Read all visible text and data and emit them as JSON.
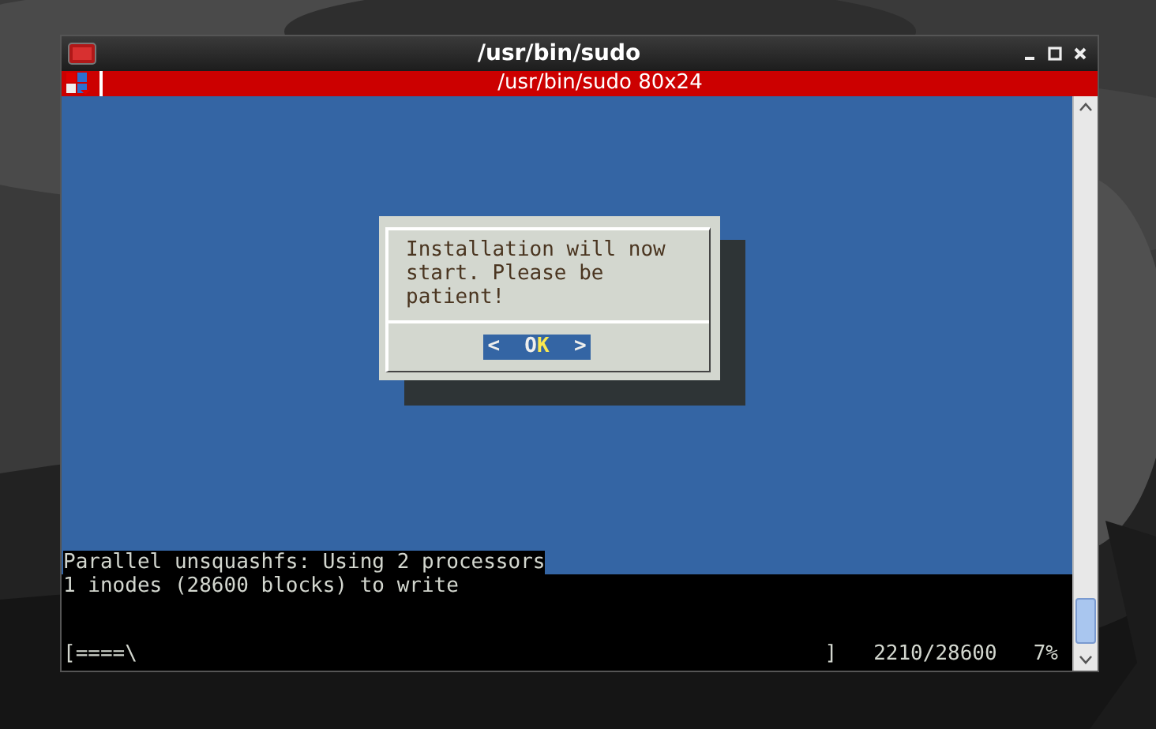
{
  "window": {
    "title": "/usr/bin/sudo"
  },
  "tabs": [
    {
      "label": "/usr/bin/sudo 80x24",
      "selected": true
    }
  ],
  "dialog": {
    "message": "Installation will now\nstart. Please be\npatient!",
    "button": {
      "before": "<  O",
      "hotkey": "K",
      "after": "  >"
    }
  },
  "terminal": {
    "lines": [
      {
        "text": "Parallel unsquashfs: Using 2 processors",
        "highlight": true
      },
      {
        "text": "1 inodes (28600 blocks) to write",
        "highlight": false
      }
    ],
    "progress": {
      "bar": "[====\\",
      "end": "]",
      "count": "2210/28600",
      "percent": "7%"
    }
  }
}
